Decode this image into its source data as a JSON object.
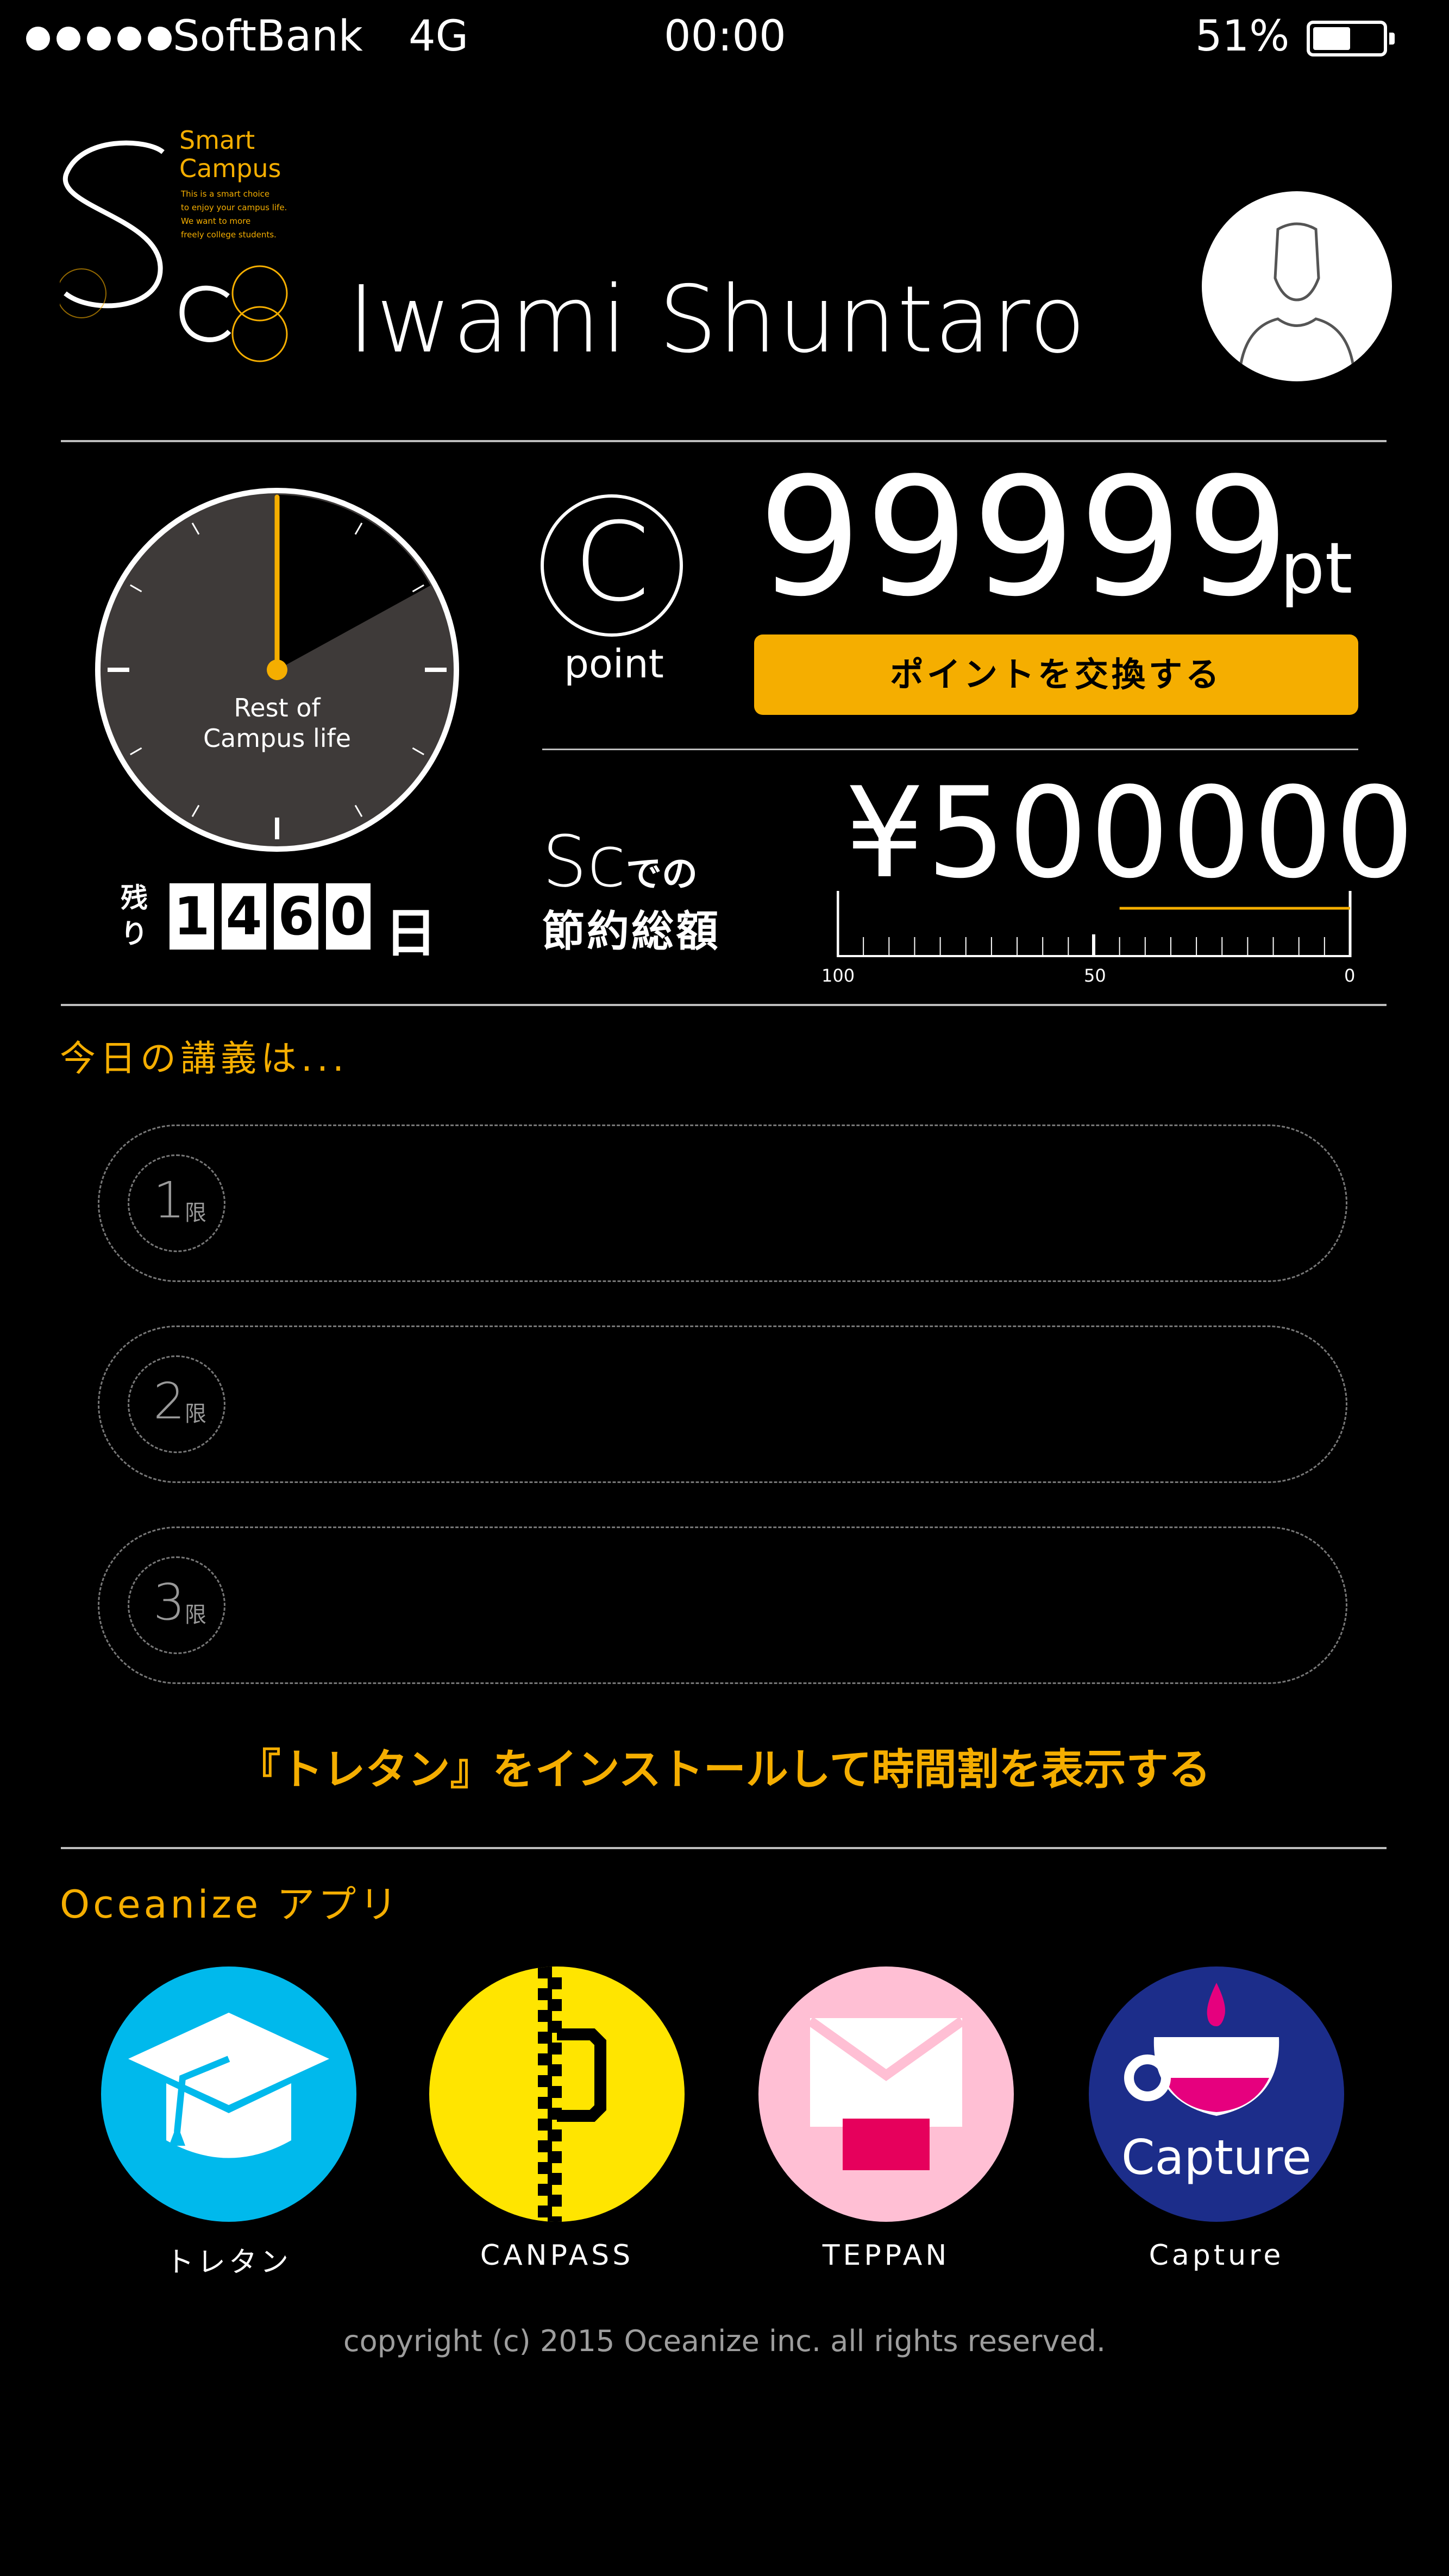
{
  "status_bar": {
    "carrier": "SoftBank",
    "network": "4G",
    "time": "00:00",
    "battery_percent": "51%",
    "battery_level": 0.51
  },
  "logo": {
    "mark": "Sc",
    "brand_line1": "Smart",
    "brand_line2": "Campus",
    "tagline": [
      "This is a smart choice",
      "to enjoy your campus life.",
      "We want to more",
      "freely college students."
    ]
  },
  "user": {
    "name": "Iwami Shuntaro",
    "avatar_icon": "person-icon"
  },
  "clock": {
    "label_line1": "Rest of",
    "label_line2": "Campus life",
    "elapsed_fraction": 0.17
  },
  "remaining": {
    "prefix_line1": "残",
    "prefix_line2": "り",
    "digits": [
      "1",
      "4",
      "6",
      "0"
    ],
    "suffix": "日"
  },
  "points": {
    "icon_letter": "C",
    "caption": "point",
    "value": "99999",
    "unit": "pt",
    "exchange_button": "ポイントを交換する"
  },
  "savings": {
    "logo": "Sc",
    "label_tail": "での",
    "label_line2": "節約総額",
    "amount": "¥500000",
    "scale_labels": [
      "100",
      "50",
      "0"
    ],
    "scale_fill_percent": 45
  },
  "today": {
    "heading": "今日の講義は...",
    "periods": [
      {
        "num": "1",
        "unit": "限"
      },
      {
        "num": "2",
        "unit": "限"
      },
      {
        "num": "3",
        "unit": "限"
      }
    ],
    "install_link": "『トレタン』をインストールして時間割を表示する"
  },
  "apps": {
    "heading": "Oceanize アプリ",
    "items": [
      {
        "label": "トレタン",
        "color": "#00b9ec",
        "icon": "graduation-cap-icon"
      },
      {
        "label": "CANPASS",
        "color": "#ffe500",
        "icon": "zipper-icon"
      },
      {
        "label": "TEPPAN",
        "color": "#ffbfd4",
        "icon": "envelope-icon"
      },
      {
        "label": "Capture",
        "color": "#1c2d8a",
        "icon": "cup-icon",
        "logo_text": "Capture"
      }
    ]
  },
  "footer": {
    "copyright": "copyright (c) 2015 Oceanize inc. all rights reserved."
  },
  "colors": {
    "accent": "#f5ae00",
    "background": "#000000",
    "clock_face": "#3e3a39"
  }
}
